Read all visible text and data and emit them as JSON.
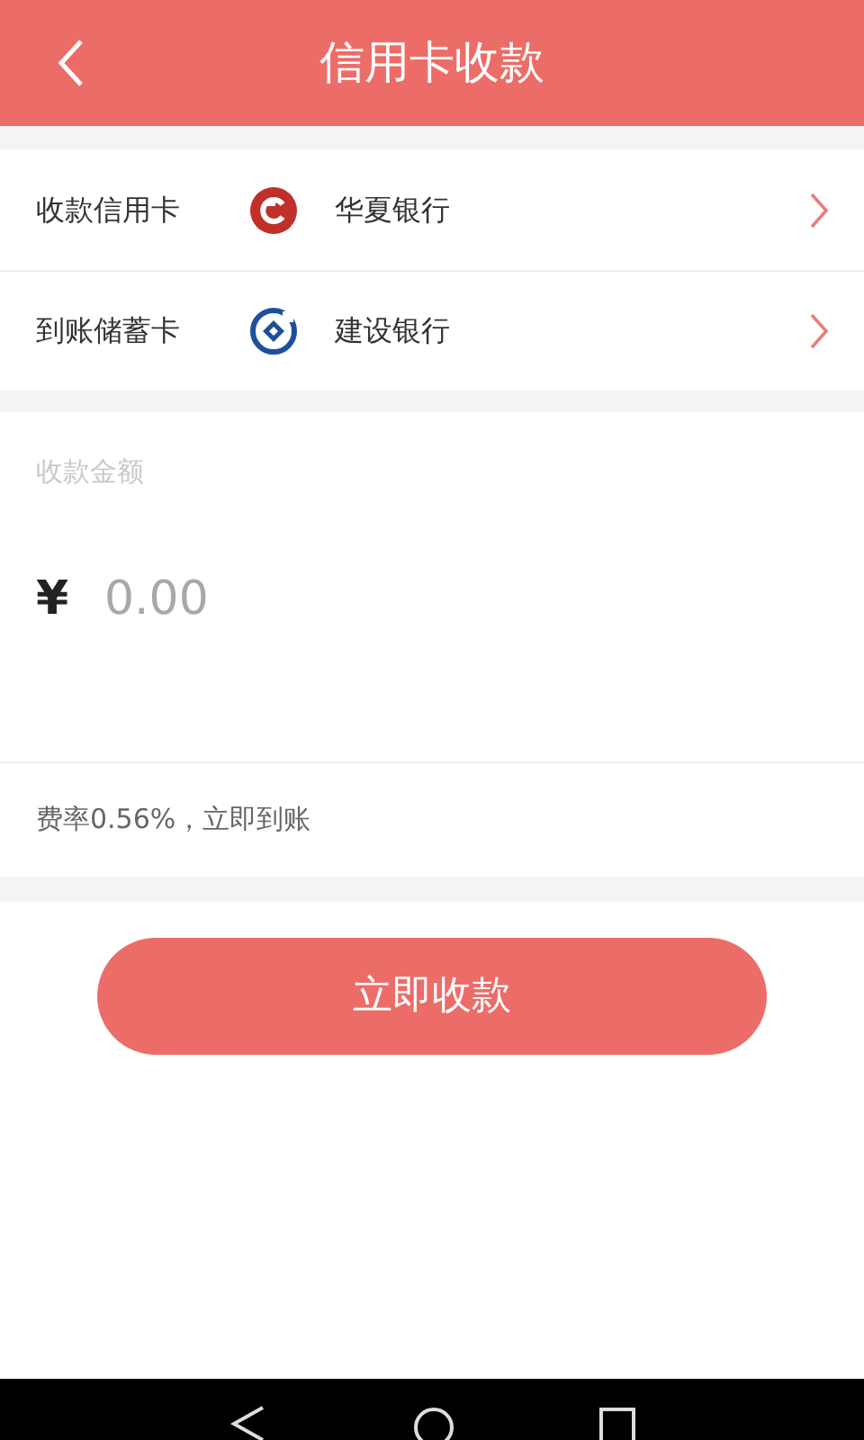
{
  "header": {
    "title": "信用卡收款"
  },
  "cards": [
    {
      "label": "收款信用卡",
      "kind": "huaxia",
      "bank": "华夏银行"
    },
    {
      "label": "到账储蓄卡",
      "kind": "ccb",
      "bank": "建设银行"
    }
  ],
  "amount": {
    "label": "收款金额",
    "currency": "¥",
    "placeholder": "0.00"
  },
  "fee_note": "费率0.56%，立即到账",
  "submit": "立即收款"
}
